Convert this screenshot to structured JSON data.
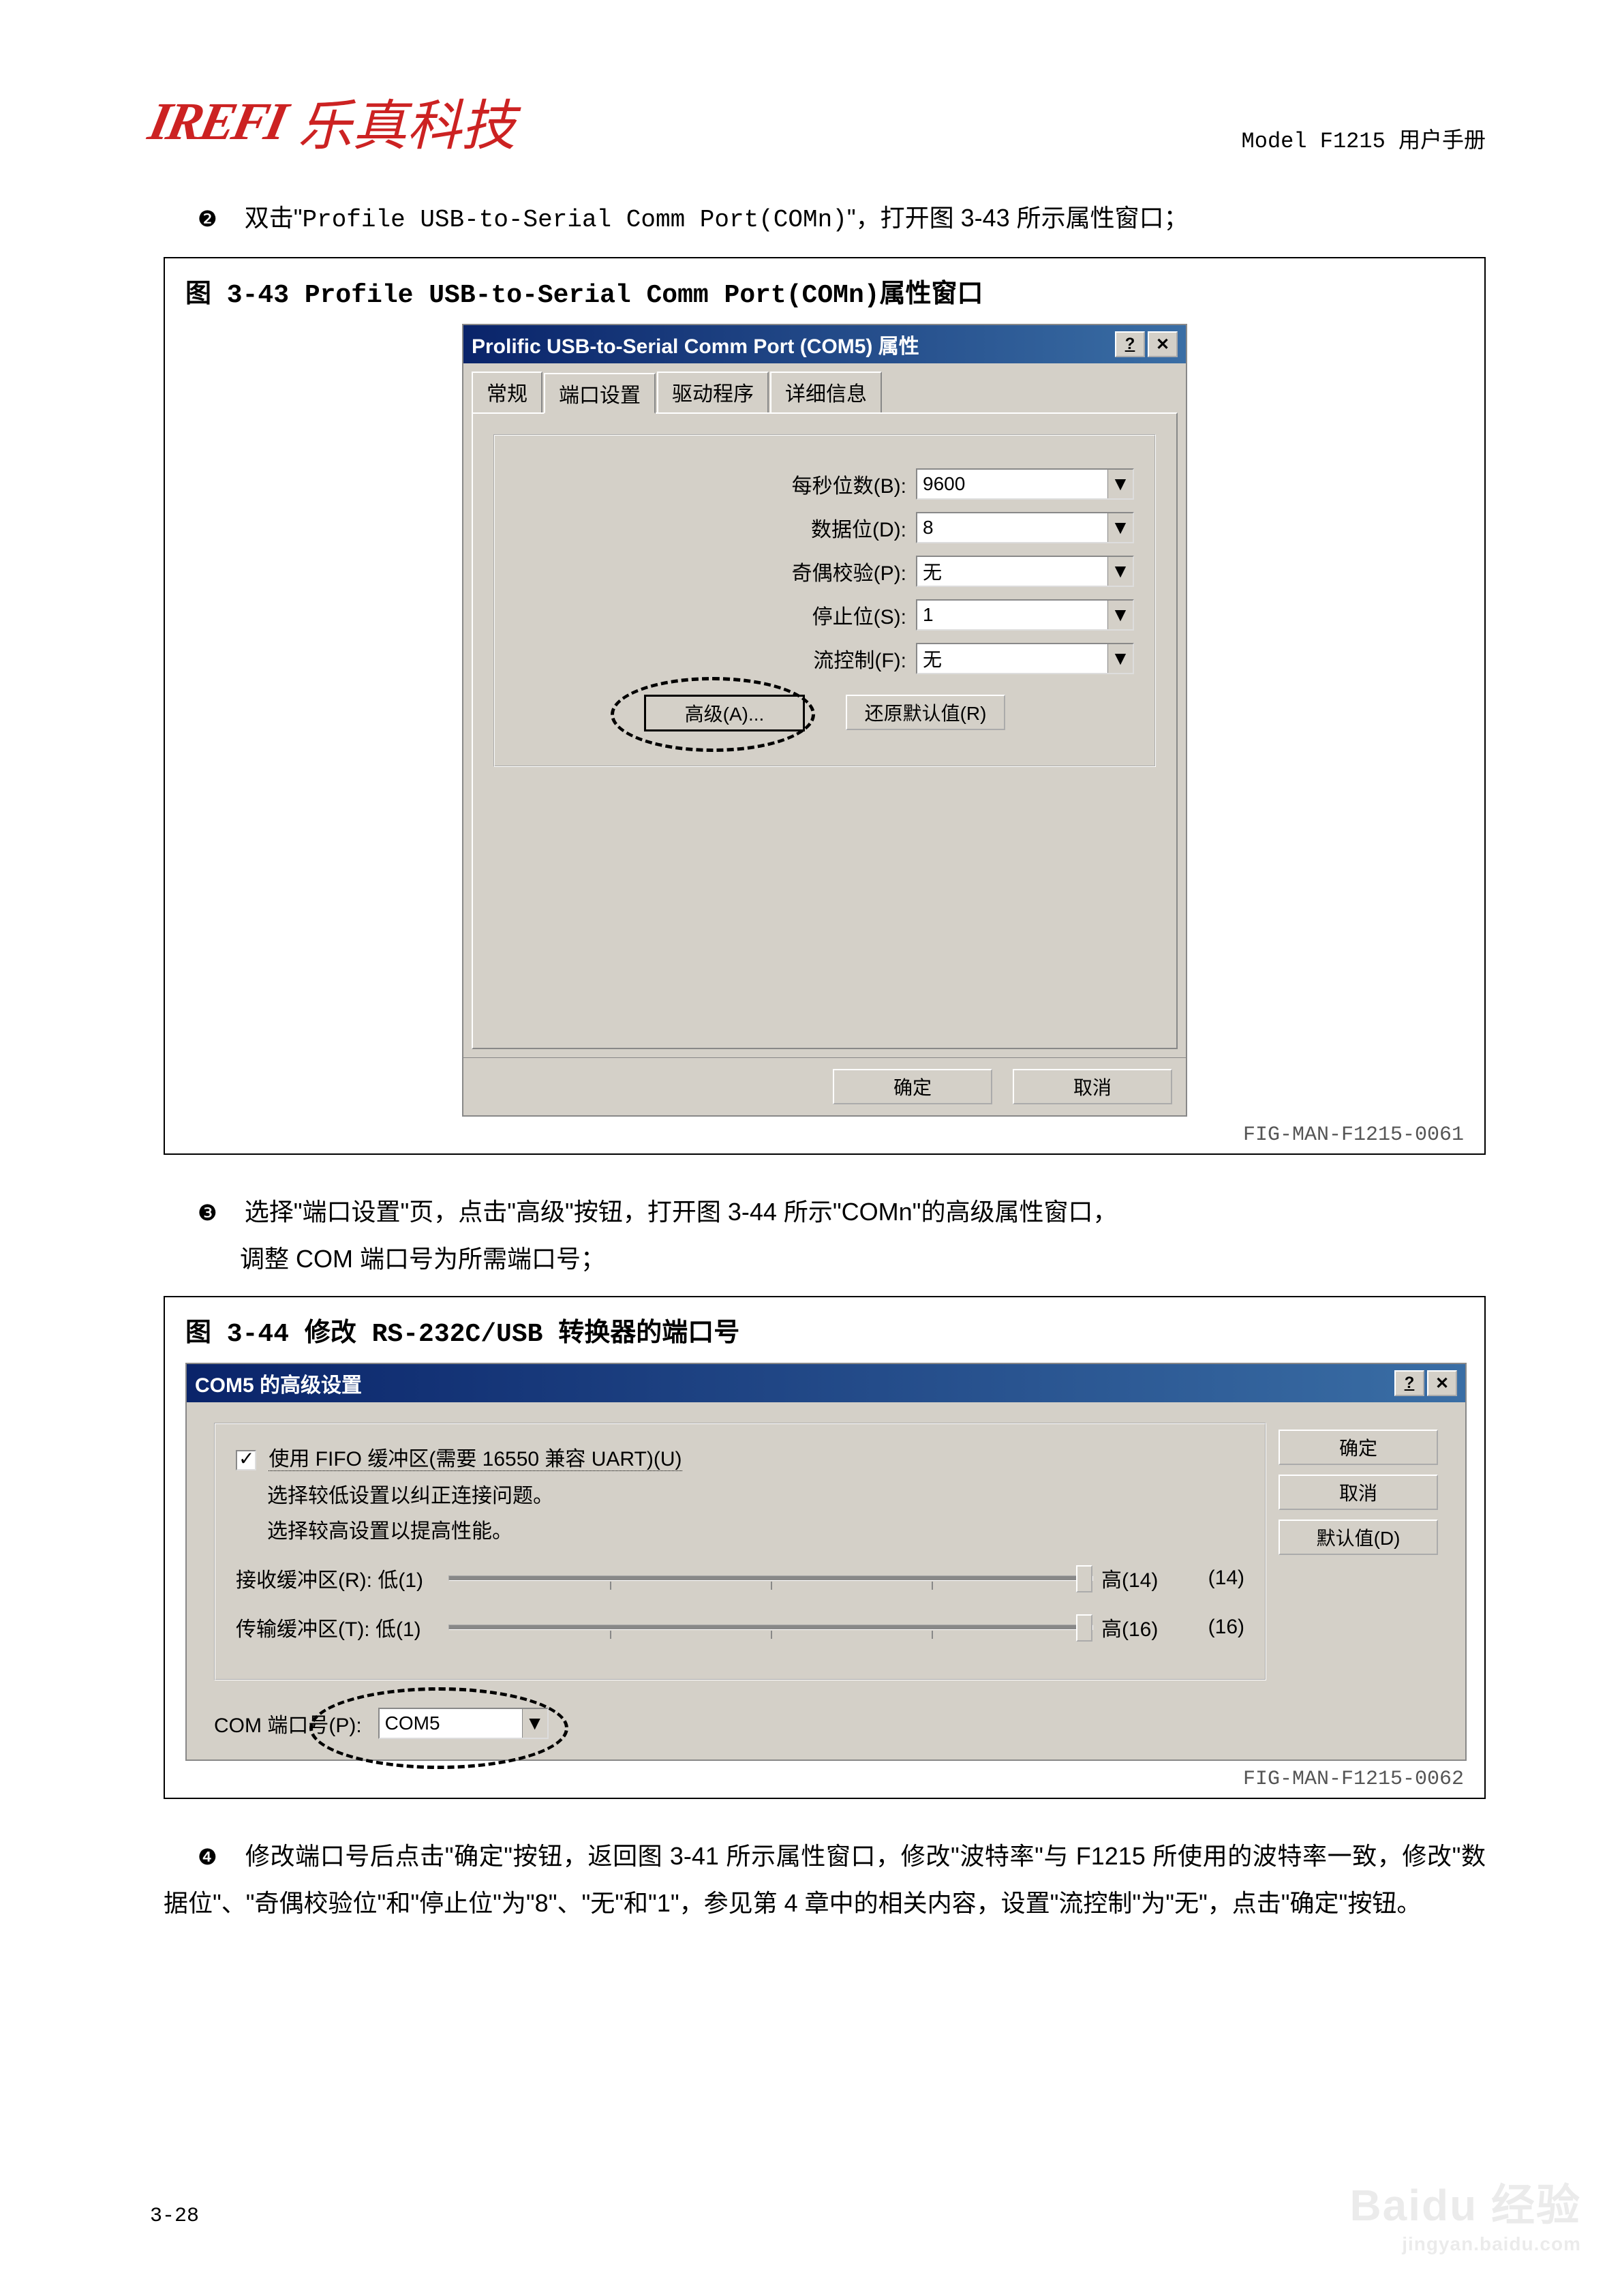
{
  "header": {
    "logo_en": "IREFI",
    "logo_cn": "乐真科技",
    "right": "Model F1215 用户手册"
  },
  "step2": {
    "bullet": "❷",
    "text_a": "双击\"",
    "code": "Profile USB-to-Serial Comm Port(COMn)",
    "text_b": "\"，打开图 3-43 所示属性窗口；"
  },
  "fig43": {
    "title": "图 3-43 Profile USB-to-Serial Comm Port(COMn)属性窗口",
    "code": "FIG-MAN-F1215-0061",
    "win_title": "Prolific USB-to-Serial Comm Port (COM5) 属性",
    "tabs": [
      "常规",
      "端口设置",
      "驱动程序",
      "详细信息"
    ],
    "fields": {
      "baud_label": "每秒位数(B):",
      "baud_value": "9600",
      "databits_label": "数据位(D):",
      "databits_value": "8",
      "parity_label": "奇偶校验(P):",
      "parity_value": "无",
      "stopbits_label": "停止位(S):",
      "stopbits_value": "1",
      "flow_label": "流控制(F):",
      "flow_value": "无"
    },
    "adv_btn": "高级(A)...",
    "restore_btn": "还原默认值(R)",
    "ok": "确定",
    "cancel": "取消"
  },
  "step3": {
    "bullet": "❸",
    "line1": "选择\"端口设置\"页，点击\"高级\"按钮，打开图 3-44 所示\"COMn\"的高级属性窗口，",
    "line2": "调整 COM 端口号为所需端口号；"
  },
  "fig44": {
    "title": "图 3-44 修改 RS-232C/USB 转换器的端口号",
    "code": "FIG-MAN-F1215-0062",
    "win_title": "COM5 的高级设置",
    "fifo_label": "使用 FIFO 缓冲区(需要 16550 兼容 UART)(U)",
    "tip1": "选择较低设置以纠正连接问题。",
    "tip2": "选择较高设置以提高性能。",
    "rx_label": "接收缓冲区(R): 低(1)",
    "rx_high": "高(14)",
    "rx_val": "(14)",
    "tx_label": "传输缓冲区(T): 低(1)",
    "tx_high": "高(16)",
    "tx_val": "(16)",
    "com_label": "COM 端口号(P):",
    "com_value": "COM5",
    "ok": "确定",
    "cancel": "取消",
    "defaults": "默认值(D)"
  },
  "step4": {
    "bullet": "❹",
    "text": "修改端口号后点击\"确定\"按钮，返回图 3-41 所示属性窗口，修改\"波特率\"与 F1215 所使用的波特率一致，修改\"数据位\"、\"奇偶校验位\"和\"停止位\"为\"8\"、\"无\"和\"1\"，参见第 4 章中的相关内容，设置\"流控制\"为\"无\"，点击\"确定\"按钮。"
  },
  "page_num": "3-28",
  "watermark": {
    "a": "Baidu 经验",
    "b": "jingyan.baidu.com"
  }
}
